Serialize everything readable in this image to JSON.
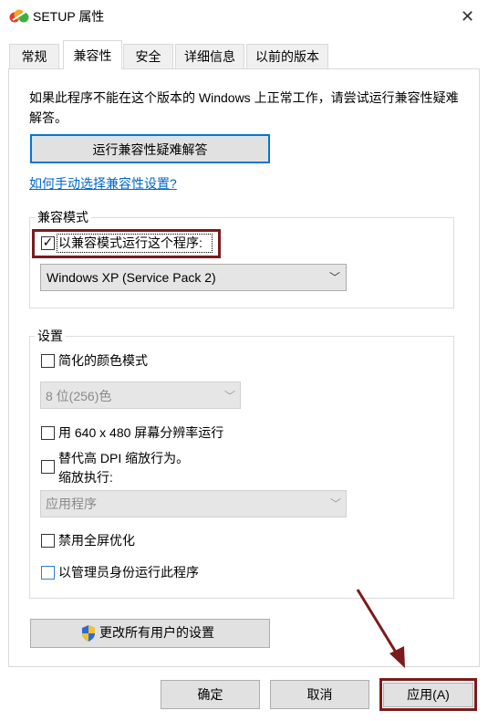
{
  "window": {
    "title": "SETUP 属性",
    "close_glyph": "✕"
  },
  "tabs": [
    {
      "label": "常规",
      "active": false
    },
    {
      "label": "兼容性",
      "active": true
    },
    {
      "label": "安全",
      "active": false
    },
    {
      "label": "详细信息",
      "active": false
    },
    {
      "label": "以前的版本",
      "active": false
    }
  ],
  "compat_tab": {
    "intro": "如果此程序不能在这个版本的 Windows 上正常工作，请尝试运行兼容性疑难解答。",
    "troubleshoot_button": "运行兼容性疑难解答",
    "manual_link": "如何手动选择兼容性设置?",
    "compat_mode": {
      "legend": "兼容模式",
      "checkbox_label": "以兼容模式运行这个程序:",
      "checked": true,
      "check_glyph": "✓",
      "selected_os": "Windows XP (Service Pack 2)"
    },
    "settings": {
      "legend": "设置",
      "reduced_color_label": "简化的颜色模式",
      "color_select_value": "8 位(256)色",
      "resolution_label": "用 640 x 480 屏幕分辨率运行",
      "dpi_label": "替代高 DPI 缩放行为。",
      "dpi_sublabel": "缩放执行:",
      "dpi_select_value": "应用程序",
      "fullscreen_label": "禁用全屏优化",
      "admin_label": "以管理员身份运行此程序"
    },
    "all_users_button": "更改所有用户的设置"
  },
  "footer": {
    "ok": "确定",
    "cancel": "取消",
    "apply": "应用(A)"
  },
  "colors": {
    "highlight_border": "#7b1b1b",
    "link": "#0066cc",
    "focus_blue": "#0078d7"
  },
  "dropdown_glyph": "﹀"
}
